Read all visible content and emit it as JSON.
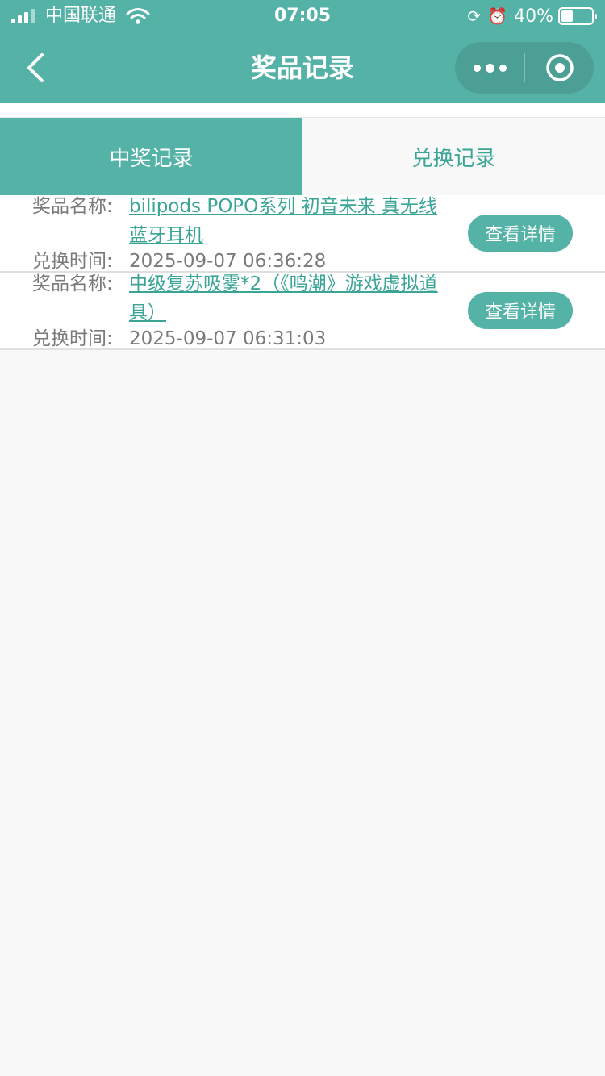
{
  "status_bar": {
    "carrier": "中国联通",
    "time": "07:05",
    "battery": "40%"
  },
  "nav": {
    "title": "奖品记录"
  },
  "tabs": [
    {
      "label": "中奖记录",
      "active": true
    },
    {
      "label": "兑换记录",
      "active": false
    }
  ],
  "records": [
    {
      "name_label": "奖品名称:",
      "name": "bilipods POPO系列 初音未来 真无线蓝牙耳机",
      "time_label": "兑换时间:",
      "time": "2025-09-07 06:36:28",
      "button": "查看详情"
    },
    {
      "name_label": "奖品名称:",
      "name": "中级复苏吸雾*2（《鸣潮》游戏虚拟道具）",
      "time_label": "兑换时间:",
      "time": "2025-09-07 06:31:03",
      "button": "查看详情"
    }
  ],
  "colors": {
    "primary": "#55b2a6",
    "link": "#3aa596",
    "background": "#f8f8f8"
  }
}
